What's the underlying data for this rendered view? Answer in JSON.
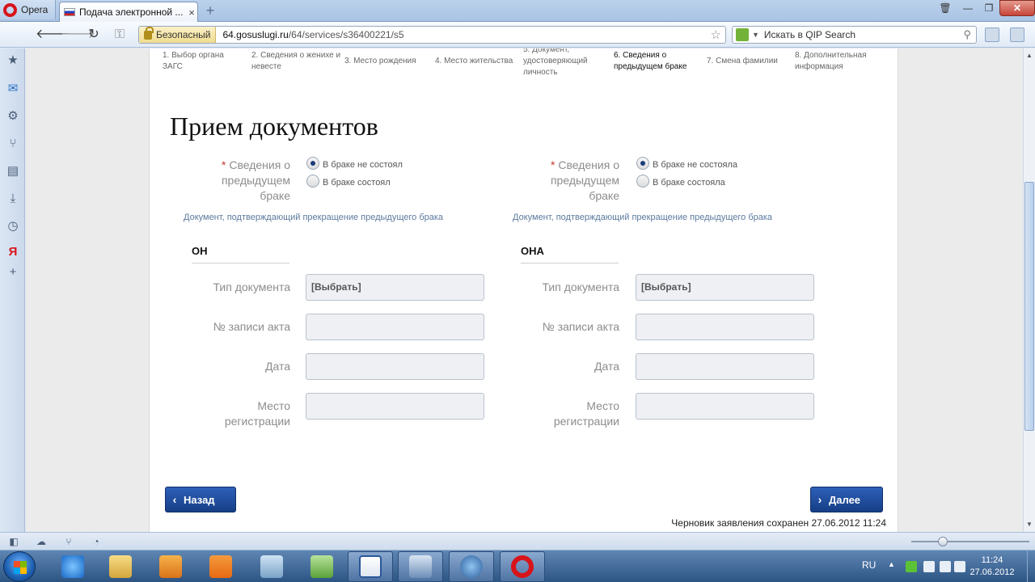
{
  "browser": {
    "menu_label": "Opera",
    "tab_title": "Подача электронной ...",
    "tab_close": "×",
    "new_tab": "+",
    "secure_label": "Безопасный",
    "url_host": "64.gosuslugi.ru",
    "url_path": "/64/services/s36400221/s5",
    "search_placeholder": "Искать в QIP Search"
  },
  "steps": [
    {
      "label": "1. Выбор органа ЗАГС"
    },
    {
      "label": "2. Сведения о женихе и невесте"
    },
    {
      "label": "3. Место рождения"
    },
    {
      "label": "4. Место жительства"
    },
    {
      "label": "5. Документ, удостоверяющий личность"
    },
    {
      "label": "6. Сведения о предыдущем браке"
    },
    {
      "label": "7. Смена фамилии"
    },
    {
      "label": "8. Дополнительная информация"
    }
  ],
  "page": {
    "title": "Прием документов",
    "left": {
      "required_mark": "*",
      "label": "Сведения о предыдущем браке",
      "options": [
        "В браке не состоял",
        "В браке состоял"
      ],
      "selected": 0,
      "doc_link": "Документ, подтверждающий прекращение предыдущего брака",
      "heading": "ОН",
      "fields": {
        "doc_type_label": "Тип документа",
        "doc_type_value": "[Выбрать]",
        "record_no_label": "№ записи акта",
        "record_no_value": "",
        "date_label": "Дата",
        "date_value": "",
        "reg_place_label": "Место регистрации",
        "reg_place_value": ""
      }
    },
    "right": {
      "required_mark": "*",
      "label": "Сведения о предыдущем браке",
      "options": [
        "В браке не состояла",
        "В браке состояла"
      ],
      "selected": 0,
      "doc_link": "Документ, подтверждающий прекращение предыдущего брака",
      "heading": "ОНА",
      "fields": {
        "doc_type_label": "Тип документа",
        "doc_type_value": "[Выбрать]",
        "record_no_label": "№ записи акта",
        "record_no_value": "",
        "date_label": "Дата",
        "date_value": "",
        "reg_place_label": "Место регистрации",
        "reg_place_value": ""
      }
    },
    "back_label": "Назад",
    "next_label": "Далее",
    "saved_text": "Черновик заявления сохранен 27.06.2012 11:24"
  },
  "taskbar": {
    "lang": "RU",
    "time": "11:24",
    "date": "27.06.2012"
  },
  "colors": {
    "accent_button": "#1f4c9c",
    "required": "#c0392b",
    "link": "#5c7a9e"
  }
}
